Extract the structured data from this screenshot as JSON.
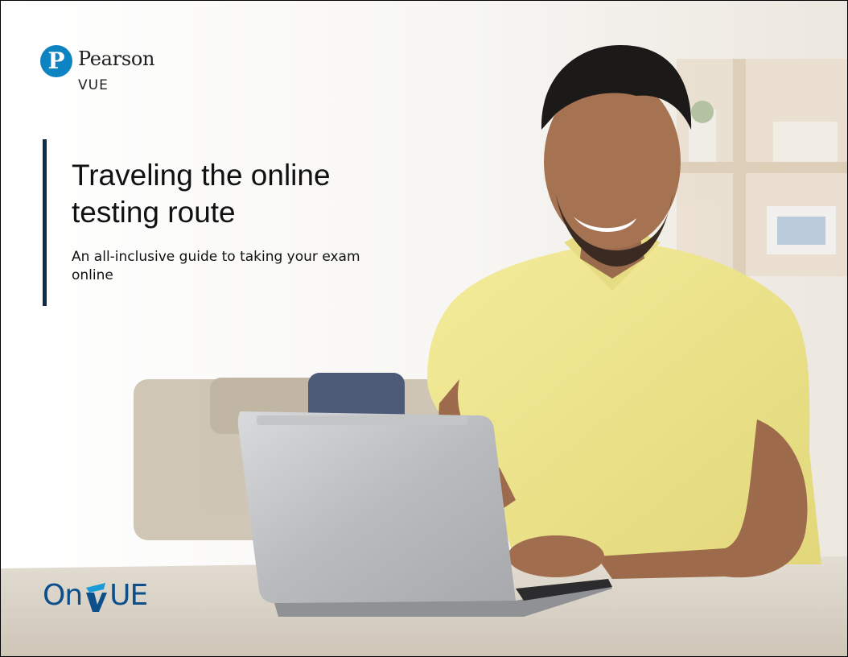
{
  "brand": {
    "logo_mark": "P",
    "name": "Pearson",
    "sub": "VUE"
  },
  "cover": {
    "title": "Traveling the online testing route",
    "subtitle": "An all-inclusive guide to taking your exam online"
  },
  "product": {
    "prefix": "On",
    "suffix": "UE"
  },
  "colors": {
    "accent_bar": "#0f2b4a",
    "brand_blue": "#0e83c1",
    "onvue_blue": "#0d4f8b"
  }
}
